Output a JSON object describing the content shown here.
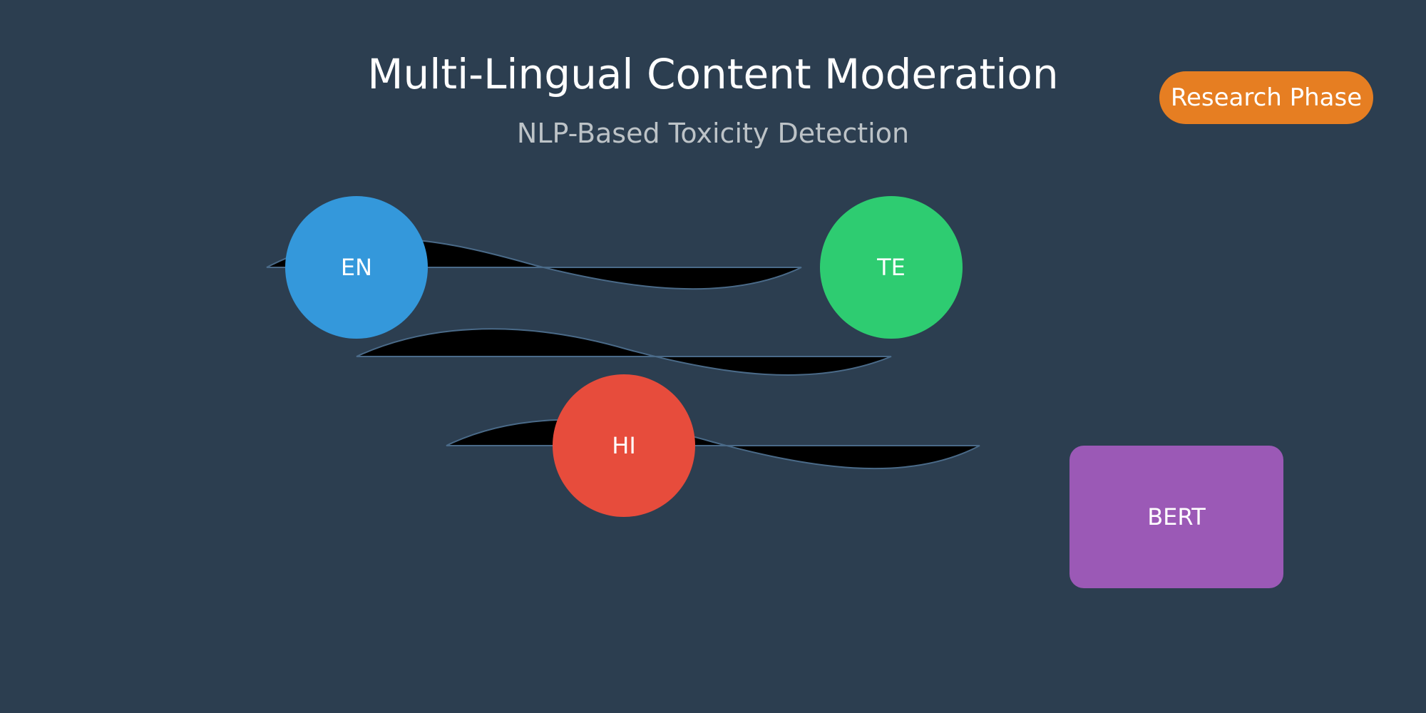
{
  "header": {
    "title": "Multi-Lingual Content Moderation",
    "subtitle": "NLP-Based Toxicity Detection"
  },
  "badge": {
    "label": "Research Phase",
    "color": "#e67e22"
  },
  "diagram": {
    "nodes": [
      {
        "id": "en",
        "label": "EN",
        "shape": "circle",
        "color": "#3498db"
      },
      {
        "id": "te",
        "label": "TE",
        "shape": "circle",
        "color": "#2ecc71"
      },
      {
        "id": "hi",
        "label": "HI",
        "shape": "circle",
        "color": "#e74c3c"
      },
      {
        "id": "bert",
        "label": "BERT",
        "shape": "rounded-rect",
        "color": "#9b59b6"
      }
    ],
    "connectors": [
      {
        "from": "en",
        "to": "te"
      },
      {
        "from": "en",
        "to": "te"
      },
      {
        "from": "hi",
        "to": "bert"
      }
    ],
    "background": "#2c3e50",
    "connector_stroke": "#4a6a88"
  }
}
